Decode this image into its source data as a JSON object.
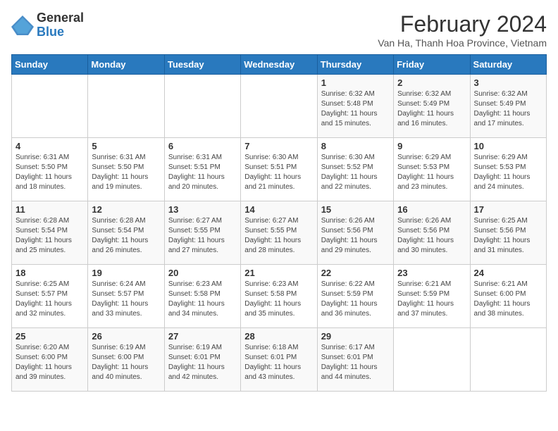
{
  "logo": {
    "general": "General",
    "blue": "Blue"
  },
  "title": "February 2024",
  "subtitle": "Van Ha, Thanh Hoa Province, Vietnam",
  "days_of_week": [
    "Sunday",
    "Monday",
    "Tuesday",
    "Wednesday",
    "Thursday",
    "Friday",
    "Saturday"
  ],
  "weeks": [
    [
      {
        "day": "",
        "info": ""
      },
      {
        "day": "",
        "info": ""
      },
      {
        "day": "",
        "info": ""
      },
      {
        "day": "",
        "info": ""
      },
      {
        "day": "1",
        "info": "Sunrise: 6:32 AM\nSunset: 5:48 PM\nDaylight: 11 hours and 15 minutes."
      },
      {
        "day": "2",
        "info": "Sunrise: 6:32 AM\nSunset: 5:49 PM\nDaylight: 11 hours and 16 minutes."
      },
      {
        "day": "3",
        "info": "Sunrise: 6:32 AM\nSunset: 5:49 PM\nDaylight: 11 hours and 17 minutes."
      }
    ],
    [
      {
        "day": "4",
        "info": "Sunrise: 6:31 AM\nSunset: 5:50 PM\nDaylight: 11 hours and 18 minutes."
      },
      {
        "day": "5",
        "info": "Sunrise: 6:31 AM\nSunset: 5:50 PM\nDaylight: 11 hours and 19 minutes."
      },
      {
        "day": "6",
        "info": "Sunrise: 6:31 AM\nSunset: 5:51 PM\nDaylight: 11 hours and 20 minutes."
      },
      {
        "day": "7",
        "info": "Sunrise: 6:30 AM\nSunset: 5:51 PM\nDaylight: 11 hours and 21 minutes."
      },
      {
        "day": "8",
        "info": "Sunrise: 6:30 AM\nSunset: 5:52 PM\nDaylight: 11 hours and 22 minutes."
      },
      {
        "day": "9",
        "info": "Sunrise: 6:29 AM\nSunset: 5:53 PM\nDaylight: 11 hours and 23 minutes."
      },
      {
        "day": "10",
        "info": "Sunrise: 6:29 AM\nSunset: 5:53 PM\nDaylight: 11 hours and 24 minutes."
      }
    ],
    [
      {
        "day": "11",
        "info": "Sunrise: 6:28 AM\nSunset: 5:54 PM\nDaylight: 11 hours and 25 minutes."
      },
      {
        "day": "12",
        "info": "Sunrise: 6:28 AM\nSunset: 5:54 PM\nDaylight: 11 hours and 26 minutes."
      },
      {
        "day": "13",
        "info": "Sunrise: 6:27 AM\nSunset: 5:55 PM\nDaylight: 11 hours and 27 minutes."
      },
      {
        "day": "14",
        "info": "Sunrise: 6:27 AM\nSunset: 5:55 PM\nDaylight: 11 hours and 28 minutes."
      },
      {
        "day": "15",
        "info": "Sunrise: 6:26 AM\nSunset: 5:56 PM\nDaylight: 11 hours and 29 minutes."
      },
      {
        "day": "16",
        "info": "Sunrise: 6:26 AM\nSunset: 5:56 PM\nDaylight: 11 hours and 30 minutes."
      },
      {
        "day": "17",
        "info": "Sunrise: 6:25 AM\nSunset: 5:56 PM\nDaylight: 11 hours and 31 minutes."
      }
    ],
    [
      {
        "day": "18",
        "info": "Sunrise: 6:25 AM\nSunset: 5:57 PM\nDaylight: 11 hours and 32 minutes."
      },
      {
        "day": "19",
        "info": "Sunrise: 6:24 AM\nSunset: 5:57 PM\nDaylight: 11 hours and 33 minutes."
      },
      {
        "day": "20",
        "info": "Sunrise: 6:23 AM\nSunset: 5:58 PM\nDaylight: 11 hours and 34 minutes."
      },
      {
        "day": "21",
        "info": "Sunrise: 6:23 AM\nSunset: 5:58 PM\nDaylight: 11 hours and 35 minutes."
      },
      {
        "day": "22",
        "info": "Sunrise: 6:22 AM\nSunset: 5:59 PM\nDaylight: 11 hours and 36 minutes."
      },
      {
        "day": "23",
        "info": "Sunrise: 6:21 AM\nSunset: 5:59 PM\nDaylight: 11 hours and 37 minutes."
      },
      {
        "day": "24",
        "info": "Sunrise: 6:21 AM\nSunset: 6:00 PM\nDaylight: 11 hours and 38 minutes."
      }
    ],
    [
      {
        "day": "25",
        "info": "Sunrise: 6:20 AM\nSunset: 6:00 PM\nDaylight: 11 hours and 39 minutes."
      },
      {
        "day": "26",
        "info": "Sunrise: 6:19 AM\nSunset: 6:00 PM\nDaylight: 11 hours and 40 minutes."
      },
      {
        "day": "27",
        "info": "Sunrise: 6:19 AM\nSunset: 6:01 PM\nDaylight: 11 hours and 42 minutes."
      },
      {
        "day": "28",
        "info": "Sunrise: 6:18 AM\nSunset: 6:01 PM\nDaylight: 11 hours and 43 minutes."
      },
      {
        "day": "29",
        "info": "Sunrise: 6:17 AM\nSunset: 6:01 PM\nDaylight: 11 hours and 44 minutes."
      },
      {
        "day": "",
        "info": ""
      },
      {
        "day": "",
        "info": ""
      }
    ]
  ]
}
